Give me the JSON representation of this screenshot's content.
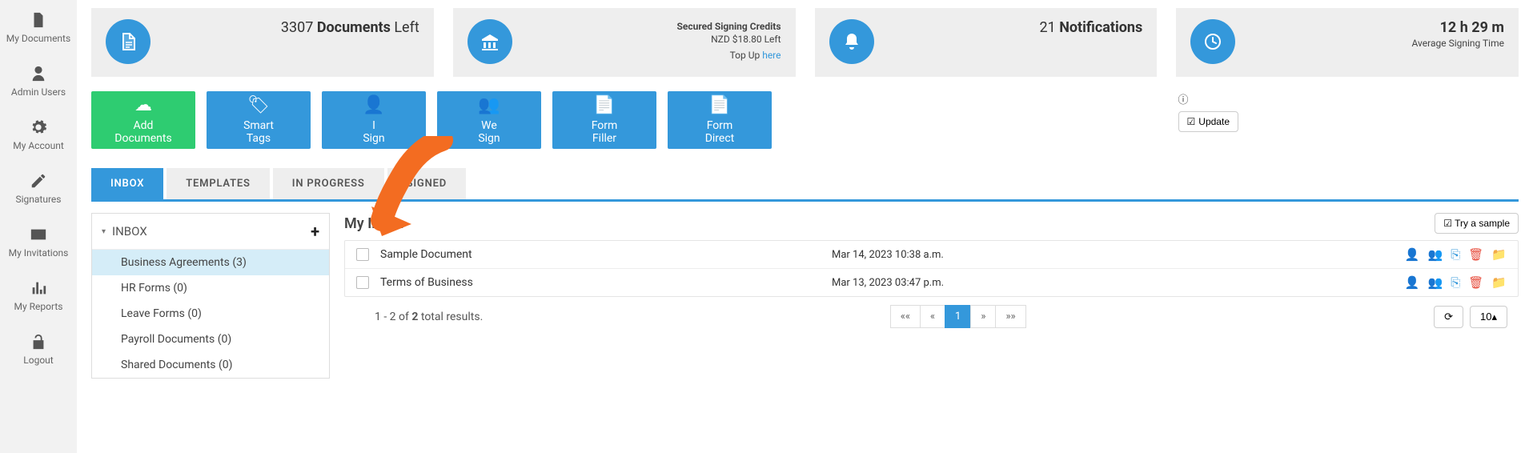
{
  "rail": [
    {
      "icon": "file",
      "label": "My Documents"
    },
    {
      "icon": "user",
      "label": "Admin Users"
    },
    {
      "icon": "gear",
      "label": "My Account"
    },
    {
      "icon": "pencil",
      "label": "Signatures"
    },
    {
      "icon": "envelope",
      "label": "My Invitations"
    },
    {
      "icon": "chart",
      "label": "My Reports"
    },
    {
      "icon": "unlock",
      "label": "Logout"
    }
  ],
  "cards": {
    "docs": {
      "num": "3307",
      "bold": "Documents",
      "suffix": "Left"
    },
    "credits": {
      "title": "Secured Signing Credits",
      "sub": "NZD $18.80 Left",
      "topup_pre": "Top Up ",
      "topup_link": "here"
    },
    "notif": {
      "num": "21",
      "bold": "Notifications"
    },
    "time": {
      "num": "12 h 29 m",
      "sub": "Average Signing Time"
    }
  },
  "tiles": [
    {
      "label": "Add Documents",
      "add": true
    },
    {
      "label": "Smart Tags"
    },
    {
      "label": "I Sign"
    },
    {
      "label": "We Sign"
    },
    {
      "label": "Form Filler"
    },
    {
      "label": "Form Direct"
    }
  ],
  "update_button": "Update",
  "tabs": [
    {
      "label": "INBOX",
      "active": true
    },
    {
      "label": "TEMPLATES"
    },
    {
      "label": "IN PROGRESS"
    },
    {
      "label": "SIGNED"
    }
  ],
  "folders": {
    "head": "INBOX",
    "items": [
      {
        "label": "Business Agreements (3)",
        "sel": true
      },
      {
        "label": "HR Forms (0)"
      },
      {
        "label": "Leave Forms (0)"
      },
      {
        "label": "Payroll Documents (0)"
      },
      {
        "label": "Shared Documents (0)"
      }
    ]
  },
  "inbox": {
    "title": "My Inbox",
    "try_sample": "Try a sample",
    "rows": [
      {
        "name": "Sample Document",
        "date": "Mar 14, 2023 10:38 a.m."
      },
      {
        "name": "Terms of Business",
        "date": "Mar 13, 2023 03:47 p.m."
      }
    ],
    "results_pre": "1 - 2 of ",
    "results_bold": "2",
    "results_post": " total results.",
    "pager": [
      "««",
      "«",
      "1",
      "»",
      "»»"
    ],
    "pagesize": "10"
  }
}
